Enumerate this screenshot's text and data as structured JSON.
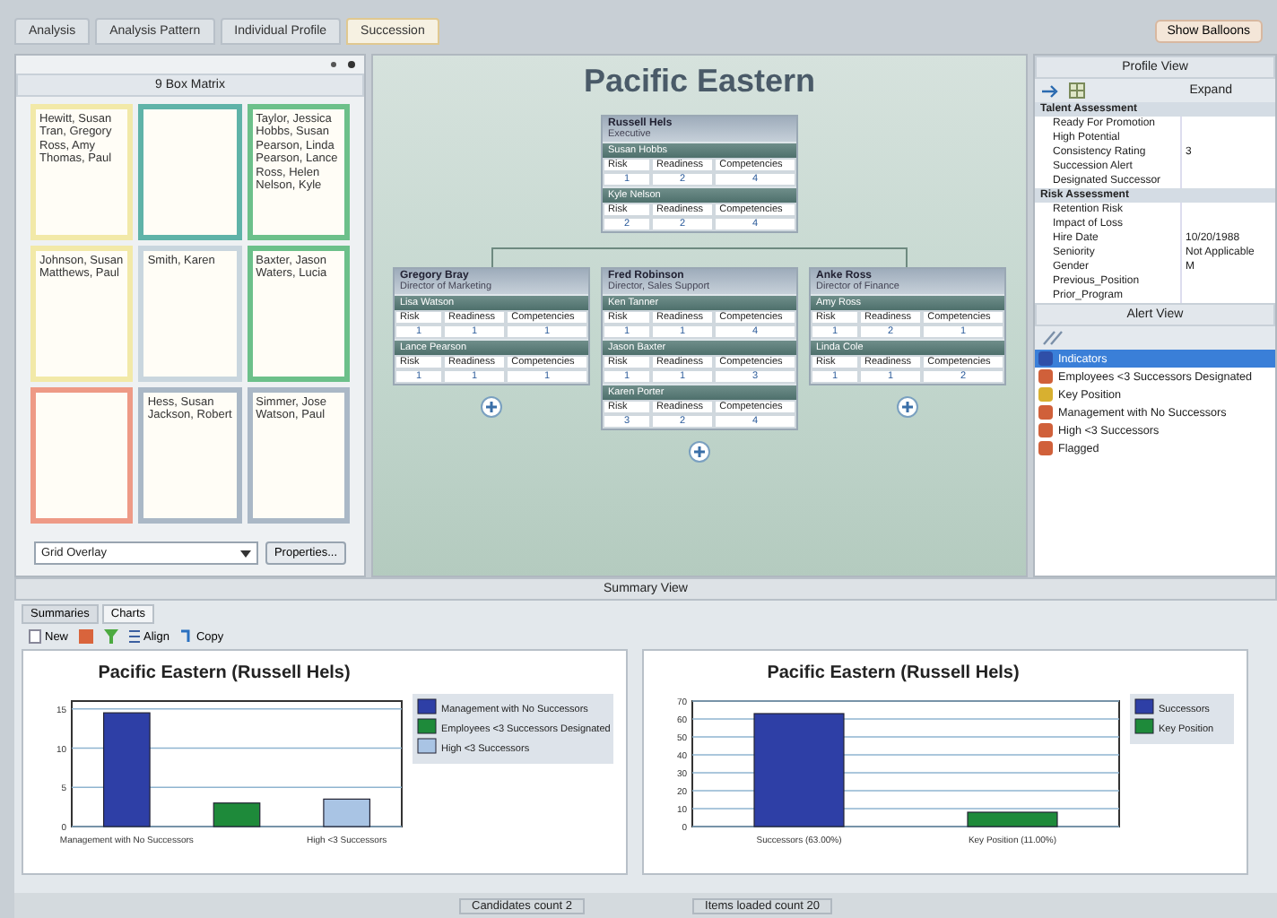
{
  "tabs": [
    {
      "label": "Analysis",
      "selected": false
    },
    {
      "label": "Analysis Pattern",
      "selected": false
    },
    {
      "label": "Individual Profile",
      "selected": false
    },
    {
      "label": "Succession",
      "selected": true
    }
  ],
  "show_button": "Show Balloons",
  "matrix": {
    "title": "9 Box Matrix",
    "dropdown": "Grid Overlay",
    "button": "Properties...",
    "cells": [
      {
        "names": [
          "Hewitt, Susan",
          "Tran, Gregory",
          "Ross, Amy",
          "Thomas, Paul"
        ],
        "color": "#f2e9a8"
      },
      {
        "color": "#5fb3a8"
      },
      {
        "names": [
          "Taylor, Jessica",
          "Hobbs, Susan",
          "Pearson, Linda",
          "Pearson, Lance",
          "Ross, Helen",
          "Nelson, Kyle"
        ],
        "color": "#6cc08a"
      },
      {
        "names": [
          "Johnson, Susan",
          "Matthews, Paul"
        ],
        "color": "#f2e9a8"
      },
      {
        "names": [
          "Smith, Karen"
        ],
        "color": "#c9d6de"
      },
      {
        "names": [
          "Baxter, Jason",
          "Waters, Lucia"
        ],
        "color": "#6cc08a"
      },
      {
        "color": "#ee9a86"
      },
      {
        "names": [
          "Hess, Susan",
          "Jackson, Robert"
        ],
        "color": "#aab8c6"
      },
      {
        "names": [
          "Simmer, Jose",
          "Watson, Paul"
        ],
        "color": "#aab8c6"
      }
    ]
  },
  "org": {
    "title": "Pacific Eastern",
    "root": {
      "name": "Russell Hels",
      "role": "Executive",
      "groups": [
        {
          "candidate": "Susan Hobbs",
          "columns": [
            "Risk",
            "Readiness",
            "Competencies"
          ],
          "values": [
            "1",
            "2",
            "4"
          ]
        },
        {
          "candidate": "Kyle Nelson",
          "columns": [
            "Risk",
            "Readiness",
            "Competencies"
          ],
          "values": [
            "2",
            "2",
            "4"
          ]
        }
      ]
    },
    "children": [
      {
        "name": "Gregory Bray",
        "role": "Director of Marketing",
        "groups": [
          {
            "candidate": "Lisa Watson",
            "columns": [
              "Risk",
              "Readiness",
              "Competencies"
            ],
            "values": [
              "1",
              "1",
              "1"
            ]
          },
          {
            "candidate": "Lance Pearson",
            "columns": [
              "Risk",
              "Readiness",
              "Competencies"
            ],
            "values": [
              "1",
              "1",
              "1"
            ]
          }
        ]
      },
      {
        "name": "Fred Robinson",
        "role": "Director, Sales Support",
        "groups": [
          {
            "candidate": "Ken Tanner",
            "columns": [
              "Risk",
              "Readiness",
              "Competencies"
            ],
            "values": [
              "1",
              "1",
              "4"
            ]
          },
          {
            "candidate": "Jason Baxter",
            "columns": [
              "Risk",
              "Readiness",
              "Competencies"
            ],
            "values": [
              "1",
              "1",
              "3"
            ]
          },
          {
            "candidate": "Karen Porter",
            "columns": [
              "Risk",
              "Readiness",
              "Competencies"
            ],
            "values": [
              "3",
              "2",
              "4"
            ]
          }
        ]
      },
      {
        "name": "Anke Ross",
        "role": "Director of Finance",
        "groups": [
          {
            "candidate": "Amy Ross",
            "columns": [
              "Risk",
              "Readiness",
              "Competencies"
            ],
            "values": [
              "1",
              "2",
              "1"
            ]
          },
          {
            "candidate": "Linda Cole",
            "columns": [
              "Risk",
              "Readiness",
              "Competencies"
            ],
            "values": [
              "1",
              "1",
              "2"
            ]
          }
        ]
      }
    ]
  },
  "profile": {
    "title": "Profile View",
    "expand": "Expand",
    "sections": [
      {
        "name": "Talent Assessment",
        "rows": [
          {
            "label": "Ready For Promotion"
          },
          {
            "label": "High Potential"
          },
          {
            "label": "Consistency Rating",
            "value": "3"
          },
          {
            "label": "Succession Alert"
          },
          {
            "label": "Designated Successor"
          }
        ]
      },
      {
        "name": "Risk Assessment",
        "rows": [
          {
            "label": "Retention Risk"
          },
          {
            "label": "Impact of Loss"
          },
          {
            "label": "Hire Date",
            "value": "10/20/1988"
          },
          {
            "label": "Seniority",
            "value": "Not Applicable"
          },
          {
            "label": "Gender",
            "value": "M"
          },
          {
            "label": "Previous_Position"
          },
          {
            "label": "Prior_Program"
          }
        ]
      }
    ]
  },
  "alerts": {
    "title": "Alert View",
    "items": [
      {
        "label": "Indicators",
        "color": "#2f4fa8",
        "selected": true
      },
      {
        "label": "Employees <3 Successors Designated",
        "color": "#d0603a",
        "selected": false
      },
      {
        "label": "Key Position",
        "color": "#d8b030",
        "selected": false
      },
      {
        "label": "Management with No Successors",
        "color": "#d0603a",
        "selected": false
      },
      {
        "label": "High <3 Successors",
        "color": "#d0603a",
        "selected": false
      },
      {
        "label": "Flagged",
        "color": "#d0603a",
        "selected": false
      }
    ]
  },
  "summary": {
    "title": "Summary View",
    "tabs": [
      {
        "label": "Summaries",
        "selected": false
      },
      {
        "label": "Charts",
        "selected": true
      }
    ],
    "toolbar": [
      {
        "kind": "new",
        "label": "New"
      },
      {
        "kind": "delete"
      },
      {
        "kind": "filter"
      },
      {
        "kind": "align",
        "label": "Align"
      },
      {
        "kind": "copy",
        "label": "Copy"
      }
    ],
    "charts": [
      {
        "chart_data": {
          "type": "bar",
          "title": "Pacific Eastern (Russell Hels)",
          "categories": [
            "Management with No Successors",
            null,
            "High <3 Successors"
          ],
          "grid": true,
          "legend": true,
          "ylim": [
            0,
            16
          ],
          "yticks": [
            0,
            5,
            10,
            15
          ],
          "series": [
            {
              "name": "Management with No Successors",
              "color": "#2e3fa6",
              "values": [
                14.5,
                null,
                null
              ]
            },
            {
              "name": "Employees <3 Successors Designated",
              "color": "#1e8a3a",
              "values": [
                null,
                3,
                null
              ]
            },
            {
              "name": "High <3 Successors",
              "color": "#a9c4e4",
              "values": [
                null,
                null,
                3.5
              ]
            }
          ]
        }
      },
      {
        "chart_data": {
          "type": "bar",
          "title": "Pacific Eastern (Russell Hels)",
          "categories": [
            "Successors (63.00%)",
            "Key Position (11.00%)"
          ],
          "grid": true,
          "legend": true,
          "ylim": [
            0,
            70
          ],
          "yticks": [
            0,
            10,
            20,
            30,
            40,
            50,
            60,
            70
          ],
          "series": [
            {
              "name": "Successors",
              "color": "#2e3fa6",
              "values": [
                63,
                null
              ]
            },
            {
              "name": "Key Position",
              "color": "#1e8a3a",
              "values": [
                null,
                8
              ]
            }
          ]
        }
      }
    ]
  },
  "status": [
    "Candidates count 2",
    "Items loaded count 20"
  ]
}
